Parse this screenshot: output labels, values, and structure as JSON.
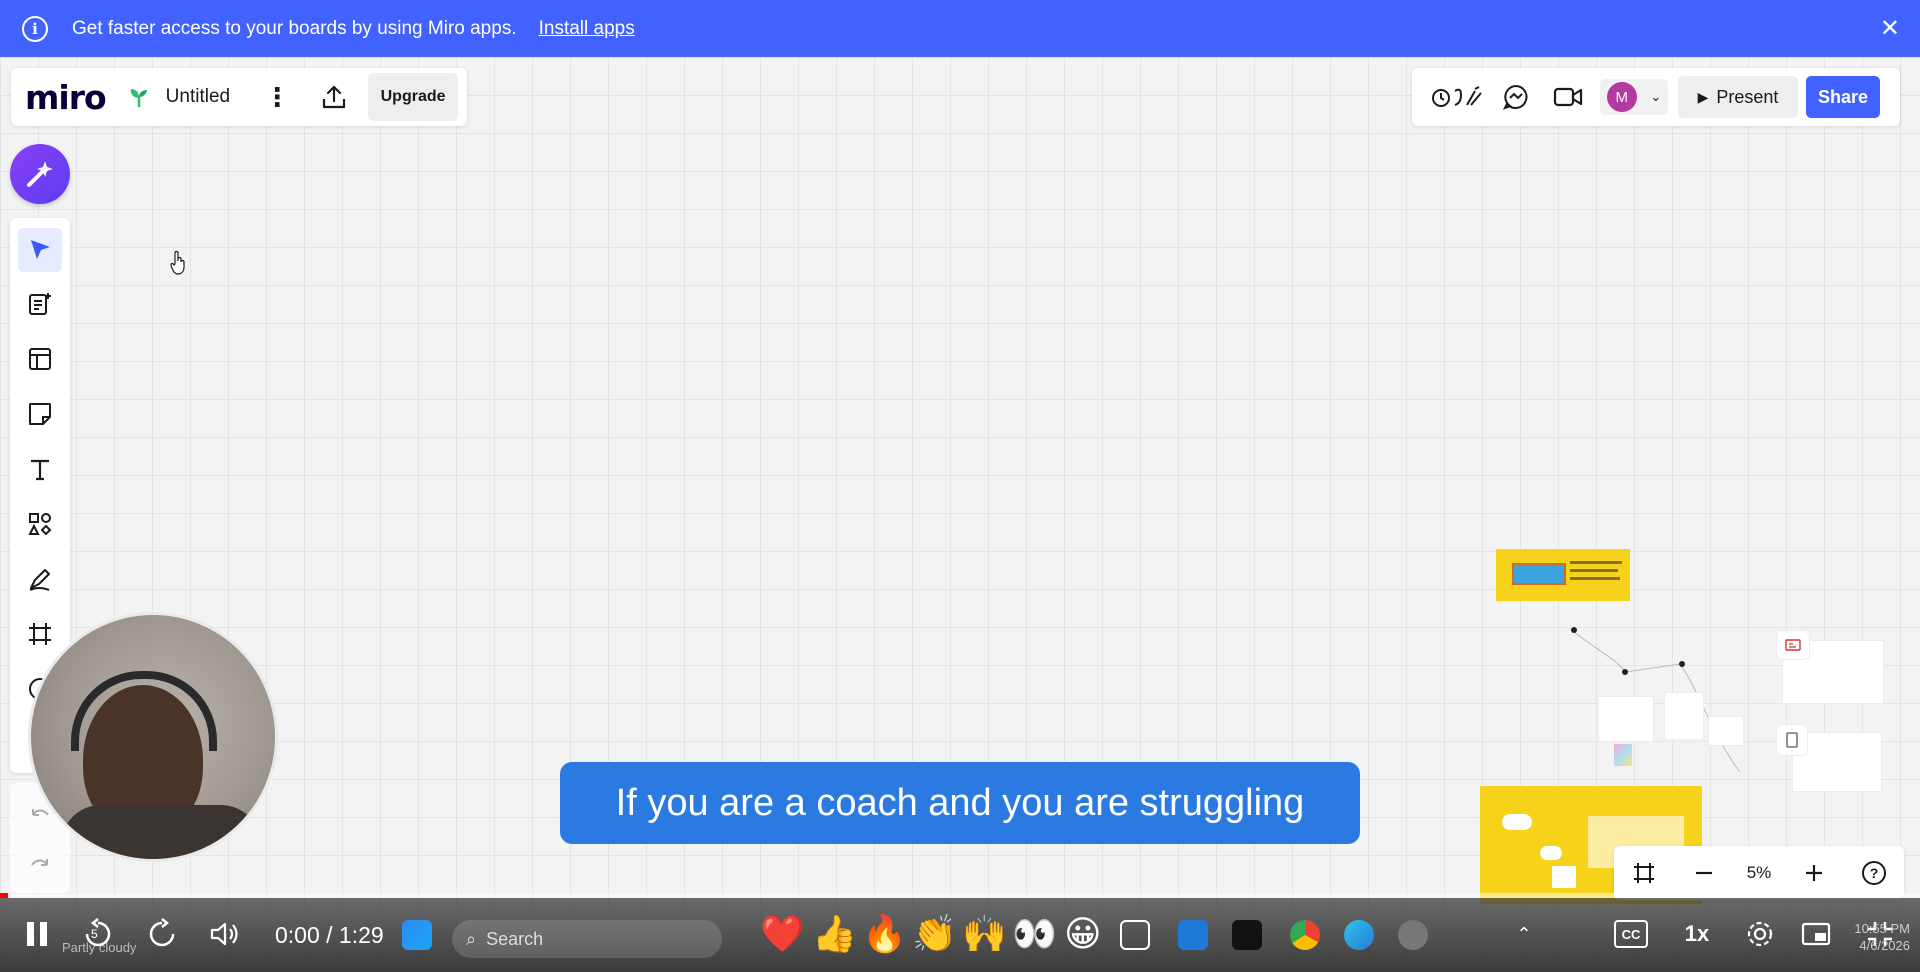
{
  "banner": {
    "message": "Get faster access to your boards by using Miro apps.",
    "install_label": "Install apps",
    "close_glyph": "✕"
  },
  "boardbar": {
    "logo": "miro",
    "title": "Untitled",
    "kebab_glyph": "⋮",
    "upgrade_label": "Upgrade"
  },
  "rightbar": {
    "avatar_initial": "M",
    "present_label": "Present",
    "share_label": "Share"
  },
  "caption": {
    "text": "If you are a coach and you are struggling"
  },
  "zoom": {
    "level": "5%"
  },
  "player": {
    "time": "0:00 / 1:29",
    "rewind_seconds": "5",
    "speed": "1x",
    "cc": "CC",
    "weather": "Partly cloudy",
    "search_placeholder": "Search",
    "date": "4/6/2026",
    "time_of_day": "10:55 PM"
  },
  "colors": {
    "accent": "#4262ff",
    "caption_bg": "#2a7ae2",
    "frame_yellow": "#f7d21a"
  }
}
